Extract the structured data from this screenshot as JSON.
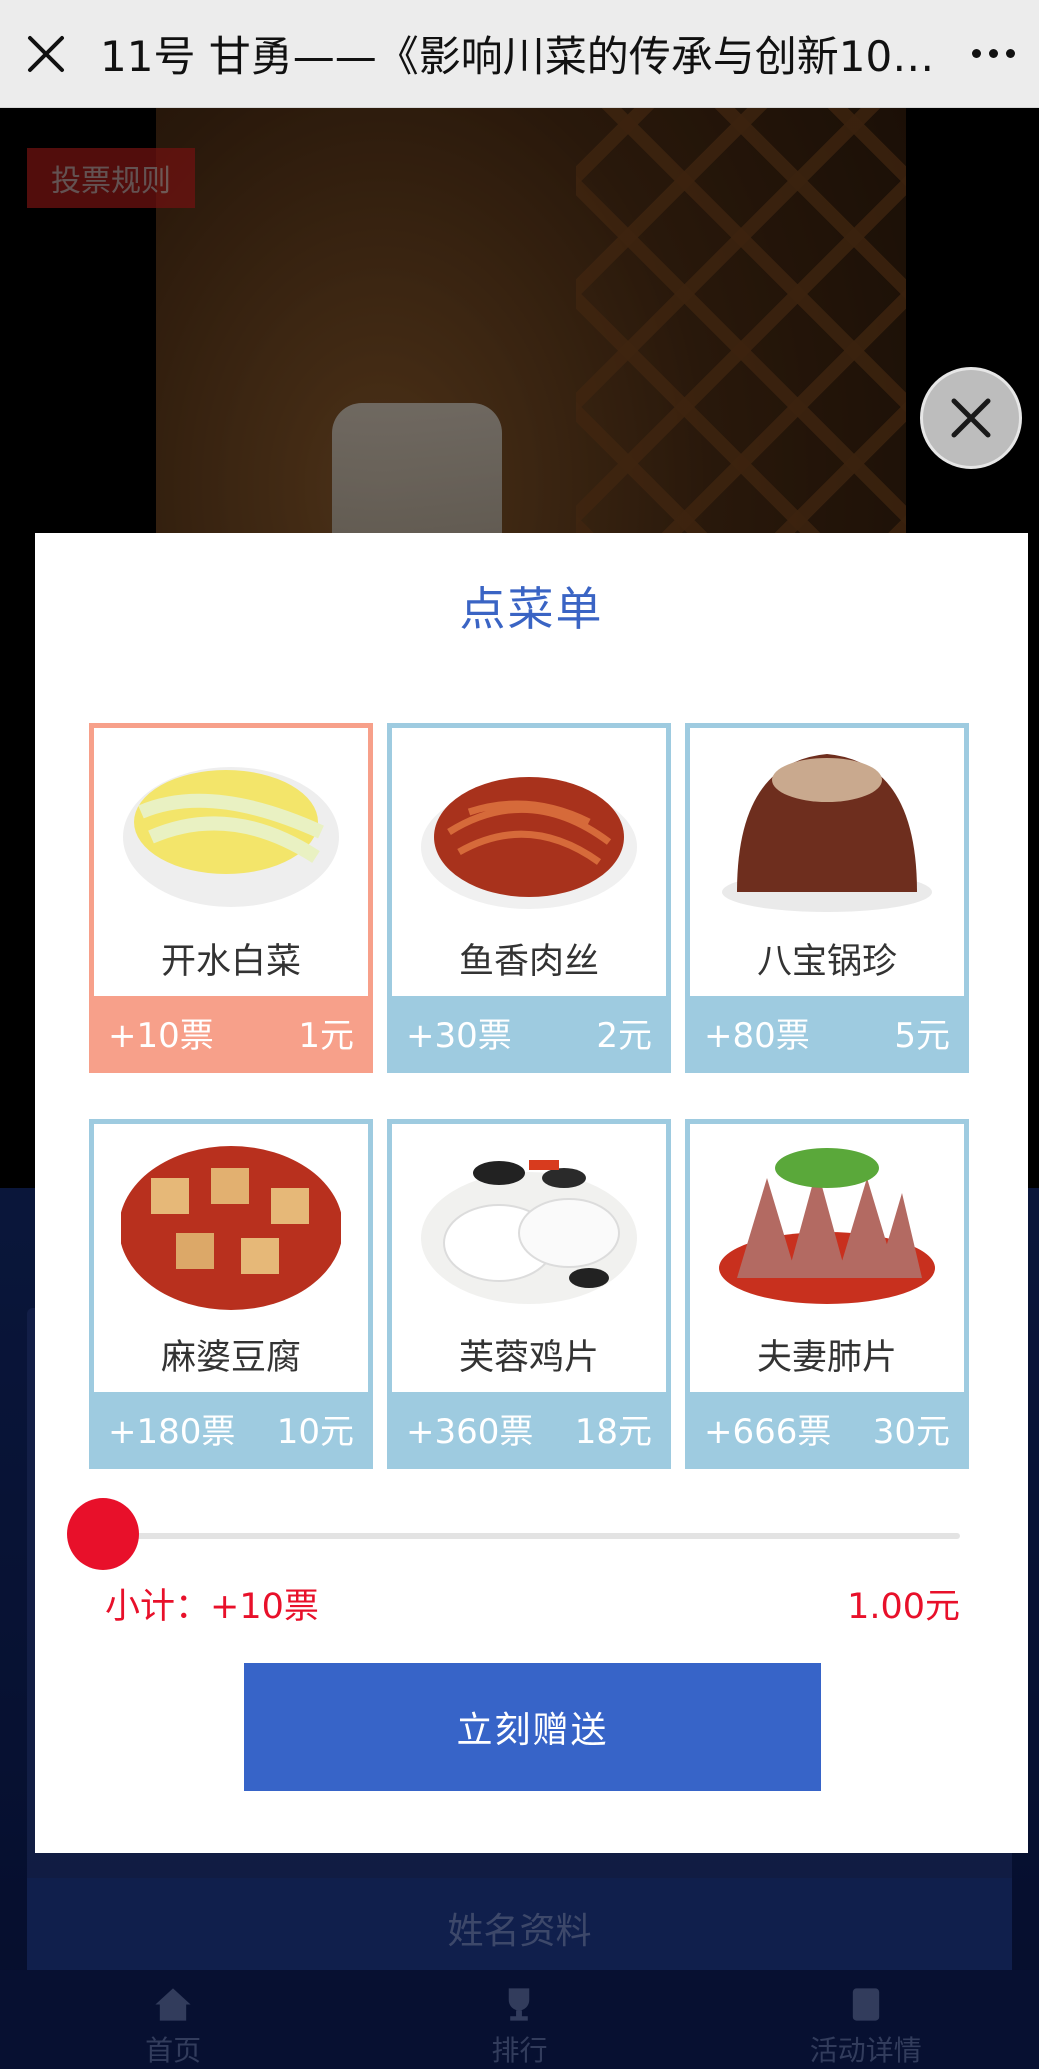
{
  "topbar": {
    "title": "11号 甘勇——《影响川菜的传承与创新100..."
  },
  "background": {
    "rules_label": "投票规则",
    "name_bar_label": "姓名资料"
  },
  "tabbar": {
    "items": [
      {
        "label": "首页",
        "icon": "home-icon"
      },
      {
        "label": "排行",
        "icon": "trophy-icon"
      },
      {
        "label": "活动详情",
        "icon": "book-icon"
      }
    ]
  },
  "modal": {
    "title": "点菜单",
    "dishes": [
      {
        "name": "开水白菜",
        "votes": "+10票",
        "price": "1元",
        "selected": true
      },
      {
        "name": "鱼香肉丝",
        "votes": "+30票",
        "price": "2元",
        "selected": false
      },
      {
        "name": "八宝锅珍",
        "votes": "+80票",
        "price": "5元",
        "selected": false
      },
      {
        "name": "麻婆豆腐",
        "votes": "+180票",
        "price": "10元",
        "selected": false
      },
      {
        "name": "芙蓉鸡片",
        "votes": "+360票",
        "price": "18元",
        "selected": false
      },
      {
        "name": "夫妻肺片",
        "votes": "+666票",
        "price": "30元",
        "selected": false
      }
    ],
    "quantity_slider_value": 0,
    "subtotal": "小计：+10票",
    "total": "1.00元",
    "send_label": "立刻赠送"
  },
  "colors": {
    "accent_blue": "#3764c8",
    "selected_orange": "#f7a08a",
    "card_blue": "#9ecbe0",
    "price_red": "#e8102a"
  }
}
